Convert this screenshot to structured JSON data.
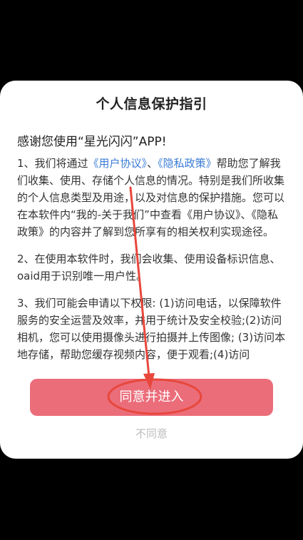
{
  "dialog": {
    "title": "个人信息保护指引",
    "greeting": "感谢您使用“星光闪闪”APP!",
    "paragraphs": {
      "p1_before_link1": "1、我们将通过",
      "p1_link1": "《用户协议》",
      "p1_between": "、",
      "p1_link2": "《隐私政策》",
      "p1_after": "帮助您了解我们收集、使用、存储个人信息的情况。特别是我们所收集的个人信息类型及用途，以及对信息的保护措施。您可以在本软件内“我的-关于我们”中查看《用户协议》、《隐私政策》的内容并了解到您所享有的相关权利实现途径。",
      "p2": "2、在使用本软件时，我们会收集、使用设备标识信息、oaid用于识别唯一用户性。",
      "p3": "3、我们可能会申请以下权限: (1)访问电话，以保障软件服务的安全运营及效率，并用于统计及安全校验;(2)访问相机，您可以使用摄像头进行拍摄并上传图像; (3)访问本地存储，帮助您缓存视频内容，便于观看;(4)访问"
    },
    "agree_label": "同意并进入",
    "disagree_label": "不同意"
  },
  "colors": {
    "agree_button": "#eb6d7a",
    "link": "#3a7bd5",
    "annotation": "#e8473c",
    "disagree_text": "#bbbbbb"
  }
}
